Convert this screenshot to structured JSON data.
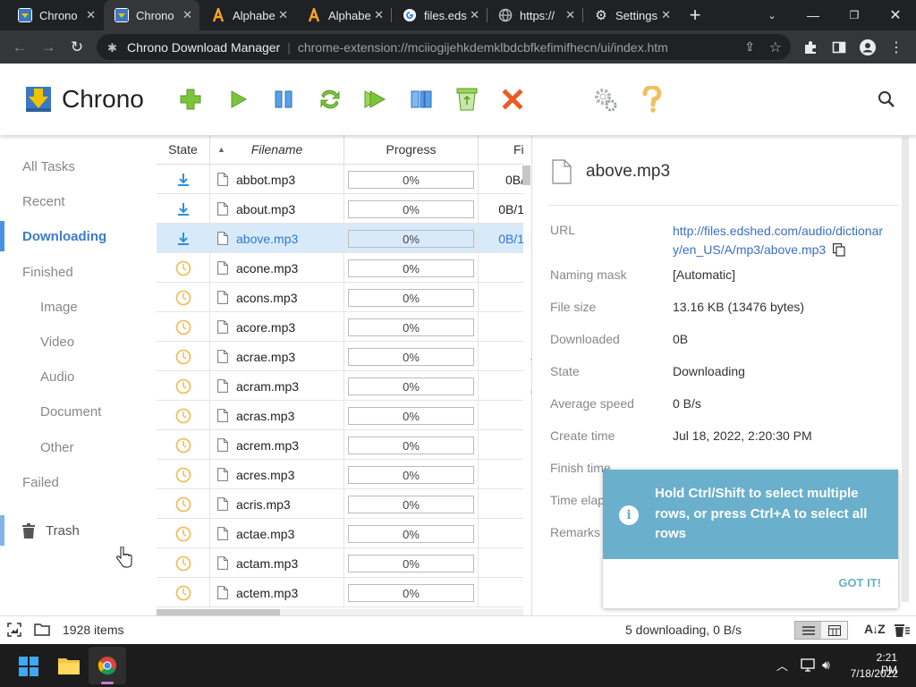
{
  "browser": {
    "tabs": [
      {
        "title": "Chrono",
        "icon": "chrono-favicon",
        "active": false
      },
      {
        "title": "Chrono",
        "icon": "chrono-favicon",
        "active": true
      },
      {
        "title": "Alphabe",
        "icon": "alphabet-favicon",
        "active": false
      },
      {
        "title": "Alphabe",
        "icon": "alphabet-favicon",
        "active": false
      },
      {
        "title": "files.eds",
        "icon": "google-favicon",
        "active": false
      },
      {
        "title": "https://",
        "icon": "globe-icon",
        "active": false
      },
      {
        "title": "Settings",
        "icon": "gear-icon",
        "active": false
      }
    ],
    "omnibox": {
      "site_name": "Chrono Download Manager",
      "url": "chrome-extension://mciiogijehkdemklbdcbfkefimifhecn/ui/index.htm"
    }
  },
  "app": {
    "name": "Chrono",
    "toolbar_icons": [
      "add-icon",
      "start-icon",
      "pause-icon",
      "refresh-icon",
      "start-all-icon",
      "pause-all-icon",
      "recycle-icon",
      "delete-icon",
      "settings-icon",
      "help-icon",
      "search-icon"
    ]
  },
  "sidebar": {
    "items": [
      {
        "label": "All Tasks"
      },
      {
        "label": "Recent"
      },
      {
        "label": "Downloading"
      },
      {
        "label": "Finished"
      },
      {
        "label": "Image"
      },
      {
        "label": "Video"
      },
      {
        "label": "Audio"
      },
      {
        "label": "Document"
      },
      {
        "label": "Other"
      },
      {
        "label": "Failed"
      },
      {
        "label": "Trash"
      }
    ],
    "active": "Downloading"
  },
  "table": {
    "headers": {
      "state": "State",
      "filename": "Filename",
      "progress": "Progress",
      "file": "File"
    },
    "rows": [
      {
        "state": "downloading",
        "filename": "abbot.mp3",
        "progress": "0%",
        "size": "0B/",
        "selected": false
      },
      {
        "state": "downloading",
        "filename": "about.mp3",
        "progress": "0%",
        "size": "0B/1",
        "selected": false
      },
      {
        "state": "downloading",
        "filename": "above.mp3",
        "progress": "0%",
        "size": "0B/1",
        "selected": true
      },
      {
        "state": "waiting",
        "filename": "acone.mp3",
        "progress": "0%",
        "size": "",
        "selected": false
      },
      {
        "state": "waiting",
        "filename": "acons.mp3",
        "progress": "0%",
        "size": "",
        "selected": false
      },
      {
        "state": "waiting",
        "filename": "acore.mp3",
        "progress": "0%",
        "size": "",
        "selected": false
      },
      {
        "state": "waiting",
        "filename": "acrae.mp3",
        "progress": "0%",
        "size": "",
        "selected": false
      },
      {
        "state": "waiting",
        "filename": "acram.mp3",
        "progress": "0%",
        "size": "",
        "selected": false
      },
      {
        "state": "waiting",
        "filename": "acras.mp3",
        "progress": "0%",
        "size": "",
        "selected": false
      },
      {
        "state": "waiting",
        "filename": "acrem.mp3",
        "progress": "0%",
        "size": "",
        "selected": false
      },
      {
        "state": "waiting",
        "filename": "acres.mp3",
        "progress": "0%",
        "size": "",
        "selected": false
      },
      {
        "state": "waiting",
        "filename": "acris.mp3",
        "progress": "0%",
        "size": "",
        "selected": false
      },
      {
        "state": "waiting",
        "filename": "actae.mp3",
        "progress": "0%",
        "size": "",
        "selected": false
      },
      {
        "state": "waiting",
        "filename": "actam.mp3",
        "progress": "0%",
        "size": "",
        "selected": false
      },
      {
        "state": "waiting",
        "filename": "actem.mp3",
        "progress": "0%",
        "size": "",
        "selected": false
      }
    ]
  },
  "detail": {
    "filename": "above.mp3",
    "url_label": "URL",
    "url_line1": "http://files.edshed.com/audio/dictionar",
    "url_line2": "y/en_US/A/mp3/above.mp3",
    "fields": [
      {
        "label": "Naming mask",
        "value": "[Automatic]"
      },
      {
        "label": "File size",
        "value": "13.16 KB (13476 bytes)"
      },
      {
        "label": "Downloaded",
        "value": "0B"
      },
      {
        "label": "State",
        "value": "Downloading"
      },
      {
        "label": "Average speed",
        "value": "0 B/s"
      },
      {
        "label": "Create time",
        "value": "Jul 18, 2022, 2:20:30 PM"
      },
      {
        "label": "Finish time",
        "value": ""
      },
      {
        "label": "Time elap",
        "value": ""
      },
      {
        "label": "Remarks",
        "value": ""
      }
    ]
  },
  "toast": {
    "message": "Hold Ctrl/Shift to select multiple rows, or press Ctrl+A to select all rows",
    "button": "GOT IT!"
  },
  "status": {
    "items_count": "1928 items",
    "summary": "5 downloading, 0 B/s"
  },
  "taskbar": {
    "time": "2:21 PM",
    "date": "7/18/2022"
  },
  "colors": {
    "accent": "#4a90e2",
    "toast": "#6aafcb",
    "progress_icon": "#2f8fd8",
    "waiting_icon": "#f0c060"
  }
}
